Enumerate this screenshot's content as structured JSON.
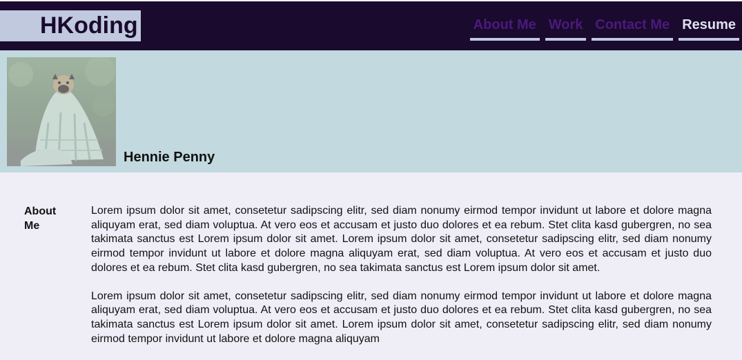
{
  "header": {
    "logo": "HKoding",
    "nav": [
      {
        "label": "About Me",
        "active": false
      },
      {
        "label": "Work",
        "active": false
      },
      {
        "label": "Contact Me",
        "active": false
      },
      {
        "label": "Resume",
        "active": true
      }
    ]
  },
  "hero": {
    "photo_icon": "pug-in-blanket-photo",
    "name": "Hennie Penny"
  },
  "about": {
    "heading": "About Me",
    "paragraphs": [
      "Lorem ipsum dolor sit amet, consetetur sadipscing elitr, sed diam nonumy eirmod tempor invidunt ut labore et dolore magna aliquyam erat, sed diam voluptua. At vero eos et accusam et justo duo dolores et ea rebum. Stet clita kasd gubergren, no sea takimata sanctus est Lorem ipsum dolor sit amet. Lorem ipsum dolor sit amet, consetetur sadipscing elitr, sed diam nonumy eirmod tempor invidunt ut labore et dolore magna aliquyam erat, sed diam voluptua. At vero eos et accusam et justo duo dolores et ea rebum. Stet clita kasd gubergren, no sea takimata sanctus est Lorem ipsum dolor sit amet.",
      "Lorem ipsum dolor sit amet, consetetur sadipscing elitr, sed diam nonumy eirmod tempor invidunt ut labore et dolore magna aliquyam erat, sed diam voluptua. At vero eos et accusam et justo duo dolores et ea rebum. Stet clita kasd gubergren, no sea takimata sanctus est Lorem ipsum dolor sit amet. Lorem ipsum dolor sit amet, consetetur sadipscing elitr, sed diam nonumy eirmod tempor invidunt ut labore et dolore magna aliquyam"
    ]
  },
  "colors": {
    "header_bg": "#1a0a2e",
    "logo_bg": "#c0c9de",
    "nav_link": "#4b1a7d",
    "nav_active": "#dfe2ef",
    "hero_bg": "#c1d9df",
    "page_bg": "#efeef7"
  }
}
